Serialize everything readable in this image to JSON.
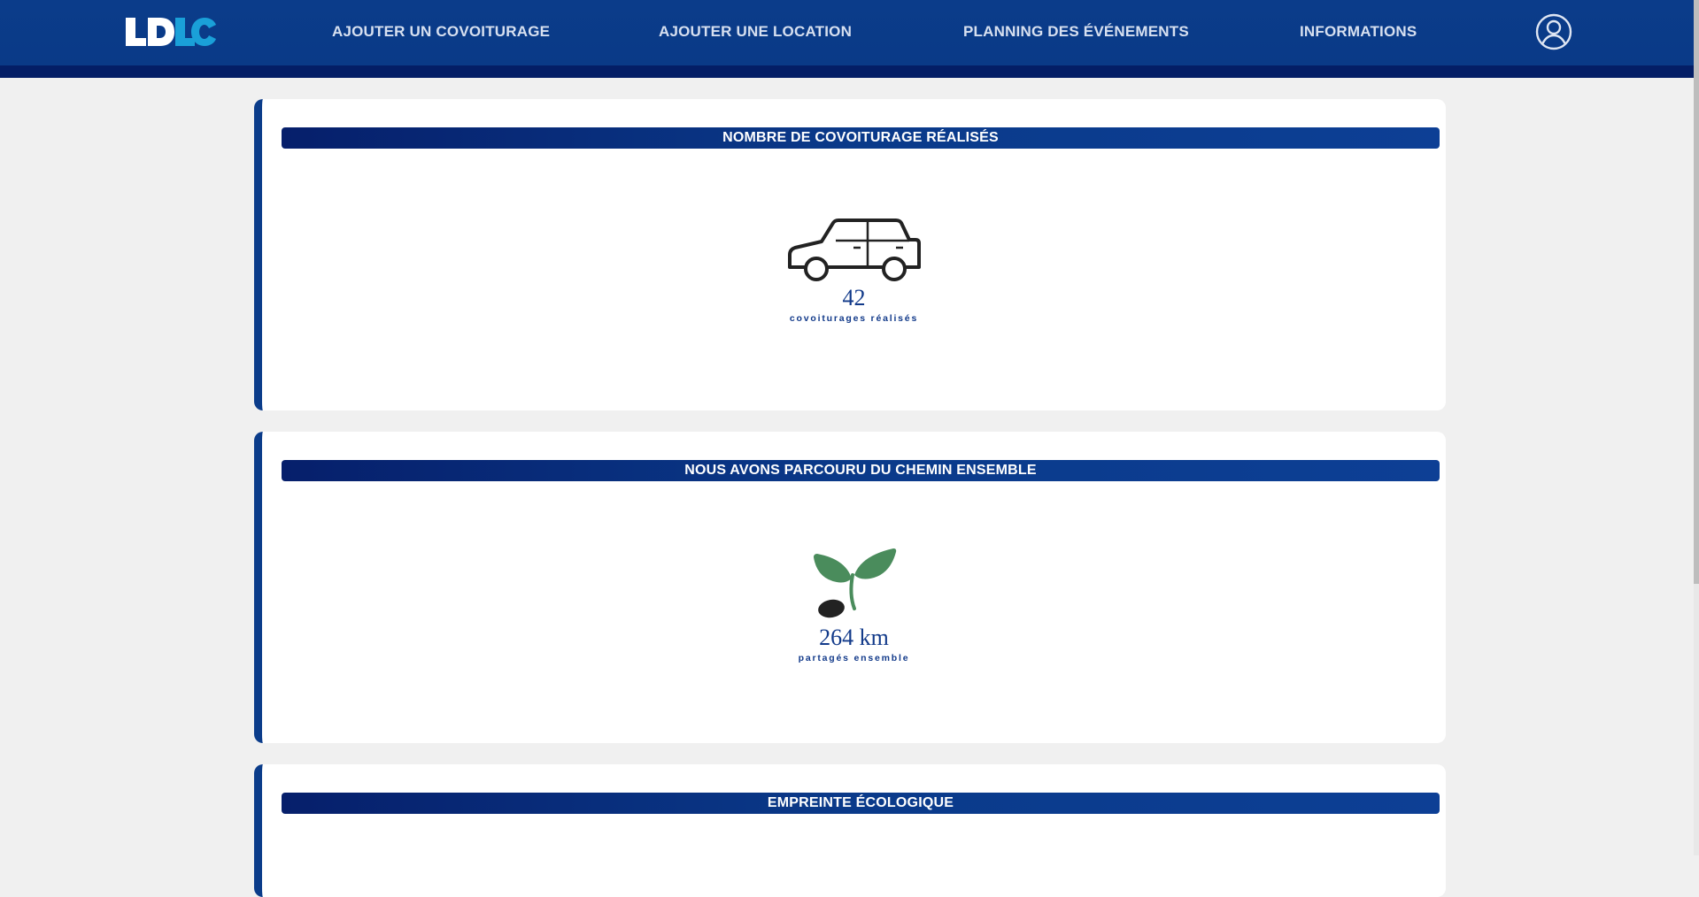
{
  "header": {
    "logo_text": "LDLC",
    "nav": [
      {
        "label": "AJOUTER UN COVOITURAGE"
      },
      {
        "label": "AJOUTER UNE LOCATION"
      },
      {
        "label": "PLANNING DES ÉVÉNEMENTS"
      },
      {
        "label": "INFORMATIONS"
      }
    ],
    "user_icon": "user-circle-icon"
  },
  "cards": [
    {
      "title": "NOMBRE DE COVOITURAGE RÉALISÉS",
      "icon": "car-icon",
      "value": "42",
      "caption": "covoiturages réalisés"
    },
    {
      "title": "NOUS AVONS PARCOURU DU CHEMIN ENSEMBLE",
      "icon": "sprout-icon",
      "value": "264 km",
      "caption": "partagés ensemble"
    },
    {
      "title": "EMPREINTE ÉCOLOGIQUE"
    }
  ],
  "colors": {
    "header_bg": "#0b3c8a",
    "header_bottom": "#041e66",
    "logo_blue": "#1aa0d8",
    "page_bg": "#f0f0f0",
    "accent_text": "#123a8a",
    "sprout_green": "#4a8c5c"
  }
}
